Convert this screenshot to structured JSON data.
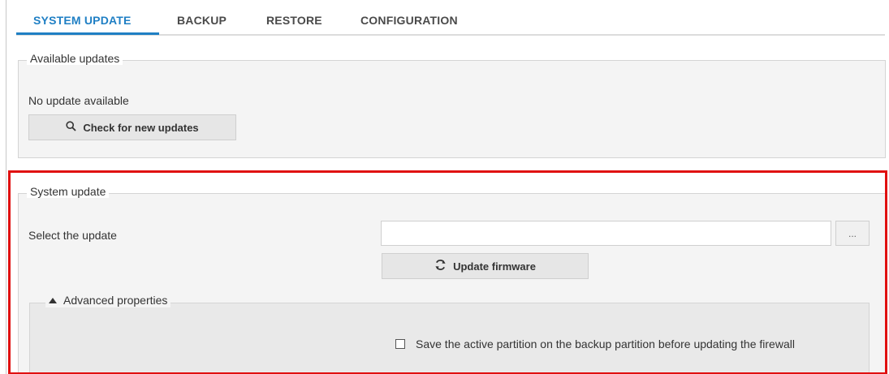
{
  "tabs": [
    {
      "label": "SYSTEM UPDATE",
      "active": true
    },
    {
      "label": "BACKUP",
      "active": false
    },
    {
      "label": "RESTORE",
      "active": false
    },
    {
      "label": "CONFIGURATION",
      "active": false
    }
  ],
  "available_updates": {
    "legend": "Available updates",
    "status": "No update available",
    "check_button": "Check for new updates",
    "check_icon": "search-icon"
  },
  "system_update": {
    "legend": "System update",
    "select_label": "Select the update",
    "file_value": "",
    "browse_label": "...",
    "update_button": "Update firmware",
    "update_icon": "refresh-icon"
  },
  "advanced": {
    "legend": "Advanced properties",
    "toggle_icon": "triangle-up-icon",
    "save_partition_label": "Save the active partition on the backup partition before updating the firewall",
    "save_partition_checked": false
  },
  "colors": {
    "accent": "#1f7fc4",
    "highlight": "#e01010"
  }
}
